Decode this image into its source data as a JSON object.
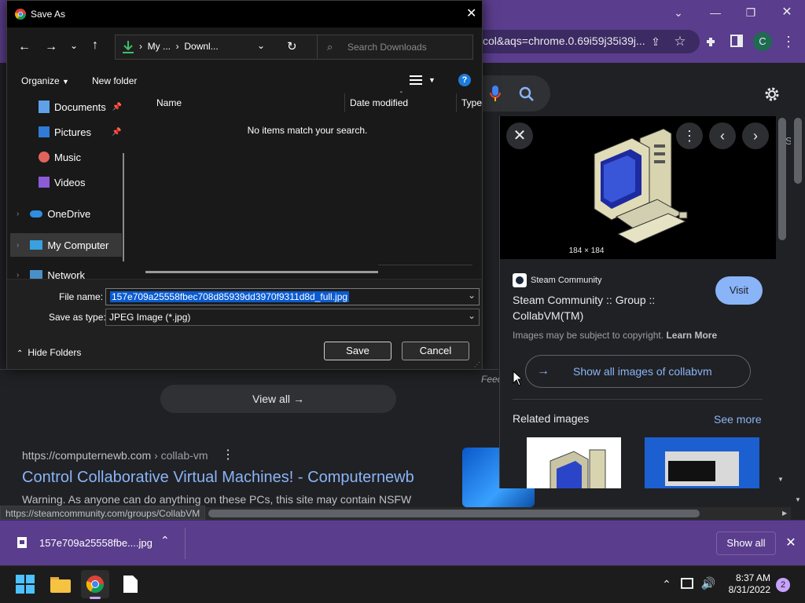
{
  "dialog": {
    "title": "Save As",
    "breadcrumb": [
      "My ...",
      "Downl..."
    ],
    "search_placeholder": "Search Downloads",
    "organize": "Organize",
    "new_folder": "New folder",
    "nav": [
      "Documents",
      "Pictures",
      "Music",
      "Videos",
      "OneDrive",
      "My Computer",
      "Network"
    ],
    "columns": [
      "Name",
      "Date modified",
      "Type"
    ],
    "empty": "No items match your search.",
    "file_name_label": "File name:",
    "file_name_value": "157e709a25558fbec708d85939dd3970f9311d8d_full.jpg",
    "save_type_label": "Save as type:",
    "save_type_value": "JPEG Image (*.jpg)",
    "hide_folders": "Hide Folders",
    "save": "Save",
    "cancel": "Cancel"
  },
  "browser": {
    "url_fragment": "col&aqs=chrome.0.69i59j35i39j...",
    "avatar": "C"
  },
  "panel": {
    "dimensions": "184 × 184",
    "source": "Steam Community",
    "title": "Steam Community :: Group :: CollabVM(TM)",
    "visit": "Visit",
    "copyright": "Images may be subject to copyright.",
    "learn_more": "Learn More",
    "show_all": "Show all images of collabvm",
    "related": "Related images",
    "see_more": "See more",
    "feed_partial": "Feec"
  },
  "results": {
    "view_all": "View all",
    "url": "https://computernewb.com",
    "url_path": "› collab-vm",
    "title": "Control Collaborative Virtual Machines! - Computernewb",
    "snippet": "Warning. As anyone can do anything on these PCs, this site may contain NSFW"
  },
  "status_url": "https://steamcommunity.com/groups/CollabVM",
  "download": {
    "filename": "157e709a25558fbe....jpg",
    "show_all": "Show all"
  },
  "taskbar": {
    "time": "8:37 AM",
    "date": "8/31/2022",
    "notifications": "2"
  }
}
